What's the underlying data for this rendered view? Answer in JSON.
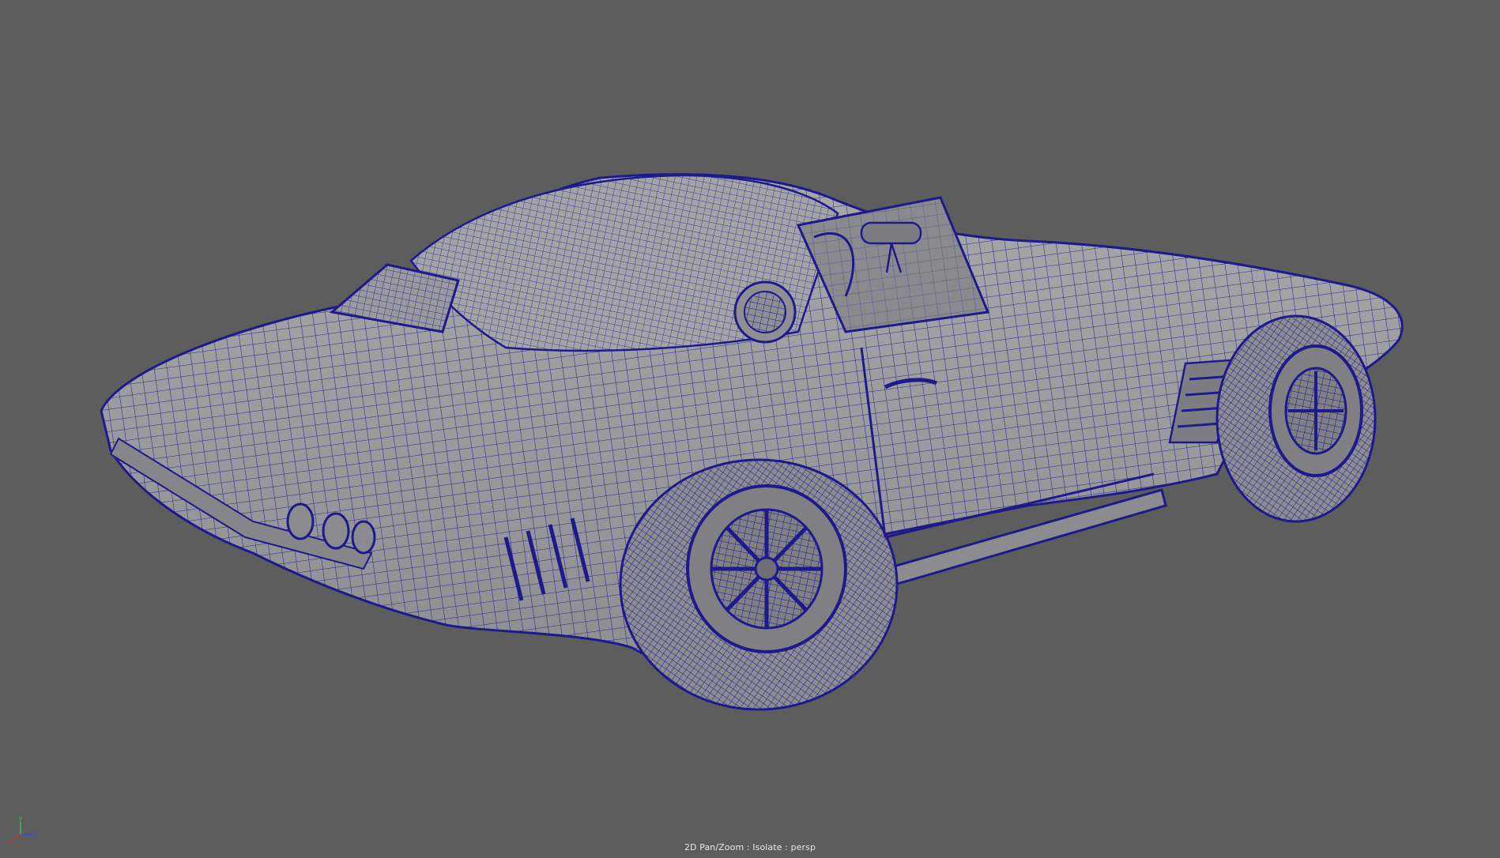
{
  "viewport": {
    "background_color": "#5d5d5d",
    "wire_color": "#1e1a8c",
    "surface_color": "#9b9b9e",
    "hud_text": "2D Pan/Zoom : Isolate : persp",
    "camera": "persp"
  },
  "model": {
    "subject": "car wireframe mesh",
    "display_mode": "wireframe-on-shaded"
  },
  "axis_gizmo": {
    "x_label": "x",
    "y_label": "y",
    "z_label": "z",
    "x_color": "#d03030",
    "y_color": "#40c040",
    "z_color": "#3050e0"
  }
}
